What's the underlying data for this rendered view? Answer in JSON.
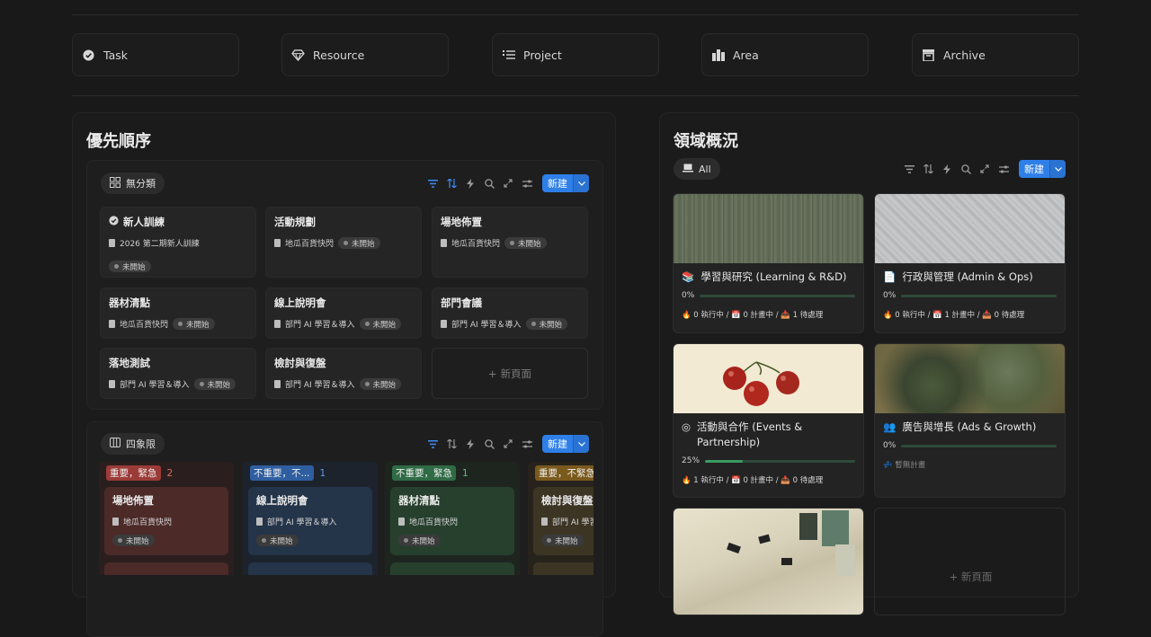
{
  "links": [
    {
      "label": "Task",
      "icon": "check-circle-icon"
    },
    {
      "label": "Resource",
      "icon": "diamond-icon"
    },
    {
      "label": "Project",
      "icon": "list-icon"
    },
    {
      "label": "Area",
      "icon": "buildings-icon"
    },
    {
      "label": "Archive",
      "icon": "archive-box-icon"
    }
  ],
  "priority": {
    "title": "優先順序",
    "board_tab": "無分類",
    "matrix_tab": "四象限",
    "new_label": "新建",
    "new_page": "新頁面",
    "cards": [
      {
        "title": "新人訓練",
        "relation": "2026 第二期新人訓練",
        "status": "未開始"
      },
      {
        "title": "活動規劃",
        "relation": "地瓜百貨快閃",
        "status": "未開始"
      },
      {
        "title": "場地佈置",
        "relation": "地瓜百貨快閃",
        "status": "未開始"
      },
      {
        "title": "器材清點",
        "relation": "地瓜百貨快閃",
        "status": "未開始"
      },
      {
        "title": "線上說明會",
        "relation": "部門 AI 學習＆導入",
        "status": "未開始"
      },
      {
        "title": "部門會議",
        "relation": "部門 AI 學習＆導入",
        "status": "未開始"
      },
      {
        "title": "落地測試",
        "relation": "部門 AI 學習＆導入",
        "status": "未開始"
      },
      {
        "title": "檢討與復盤",
        "relation": "部門 AI 學習＆導入",
        "status": "未開始"
      }
    ],
    "quadrants": [
      {
        "label": "重要，緊急",
        "count": "2",
        "label_color": "#9b3b37",
        "count_color": "#e06c63",
        "bg": "#2a1f1e",
        "card_bg": "#4b2a28",
        "card": {
          "title": "場地佈置",
          "relation": "地瓜百貨快閃",
          "status": "未開始"
        }
      },
      {
        "label": "不重要，不...",
        "count": "1",
        "label_color": "#2f5ea0",
        "count_color": "#5b9af0",
        "bg": "#1d232d",
        "card_bg": "#243449",
        "card": {
          "title": "線上說明會",
          "relation": "部門 AI 學習＆導入",
          "status": "未開始"
        }
      },
      {
        "label": "不重要，緊急",
        "count": "1",
        "label_color": "#2f6b45",
        "count_color": "#5cc27e",
        "bg": "#1e251f",
        "card_bg": "#26402d",
        "card": {
          "title": "器材清點",
          "relation": "地瓜百貨快閃",
          "status": "未開始"
        }
      },
      {
        "label": "重要，不緊急",
        "count": "",
        "label_color": "#7a5a1c",
        "count_color": "#d9a24a",
        "bg": "#27231c",
        "card_bg": "#3d3524",
        "card": {
          "title": "檢討與復盤",
          "relation": "部門 AI 學習＆導入",
          "status": "未開始"
        }
      }
    ]
  },
  "areas": {
    "title": "領域概況",
    "tab": "All",
    "new_label": "新建",
    "cards": [
      {
        "title": "學習與研究 (Learning & R&D)",
        "progress_text": "0%",
        "progress": 0,
        "stats": "🔥 0 執行中 / 📅 0 計畫中 / 📥 1 待處理"
      },
      {
        "title": "行政與管理 (Admin & Ops)",
        "progress_text": "0%",
        "progress": 0,
        "stats": "🔥 0 執行中 / 📅 1 計畫中 / 📥 0 待處理"
      },
      {
        "title": "活動與合作 (Events & Partnership)",
        "progress_text": "25%",
        "progress": 0.25,
        "stats": "🔥 1 執行中 / 📅 0 計畫中 / 📥 0 待處理"
      },
      {
        "title": "廣告與增長 (Ads & Growth)",
        "progress_text": "0%",
        "progress": 0,
        "stats": "💤 暫無計畫"
      }
    ],
    "new_page": "新頁面"
  }
}
